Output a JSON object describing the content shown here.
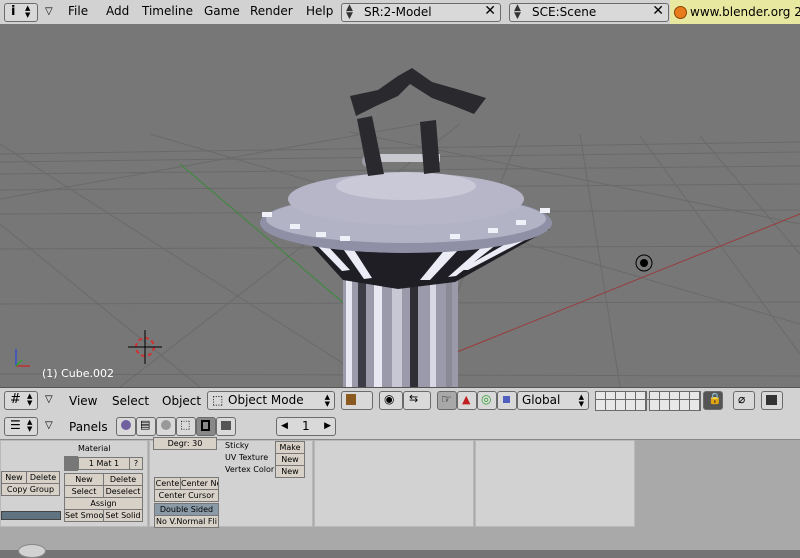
{
  "top_menu": {
    "items": [
      "File",
      "Add",
      "Timeline",
      "Game",
      "Render",
      "Help"
    ],
    "screen_field": "SR:2-Model",
    "scene_field": "SCE:Scene",
    "url": "www.blender.org 2"
  },
  "viewport": {
    "object_label": "(1) Cube.002"
  },
  "view3d_header": {
    "menus": [
      "View",
      "Select",
      "Object"
    ],
    "mode": "Object Mode",
    "orientation": "Global"
  },
  "buttons_header": {
    "panels_label": "Panels",
    "frame": "1"
  },
  "panels": {
    "material_title": "Material",
    "mat_field": "1 Mat 1",
    "mat_q": "?",
    "new": "New",
    "delete": "Delete",
    "copy_group": "Copy Group",
    "new2": "New",
    "delete2": "Delete",
    "select": "Select",
    "deselect": "Deselect",
    "assign": "Assign",
    "set_smooth": "Set Smoo",
    "set_solid": "Set Solid",
    "degr": "Degr: 30",
    "centre": "Cente",
    "centre_new": "Center Ne",
    "centre_cursor": "Center Cursor",
    "double_sided": "Double Sided",
    "no_vnormal": "No V.Normal Fli",
    "sticky": "Sticky",
    "uv_texture": "UV Texture",
    "vertex_color": "Vertex Color",
    "make": "Make",
    "new3": "New",
    "new4": "New"
  },
  "colors": {
    "ui_grey": "#d2d2d2",
    "viewport_bg": "#777777",
    "url_bg": "#e8e8a0"
  }
}
